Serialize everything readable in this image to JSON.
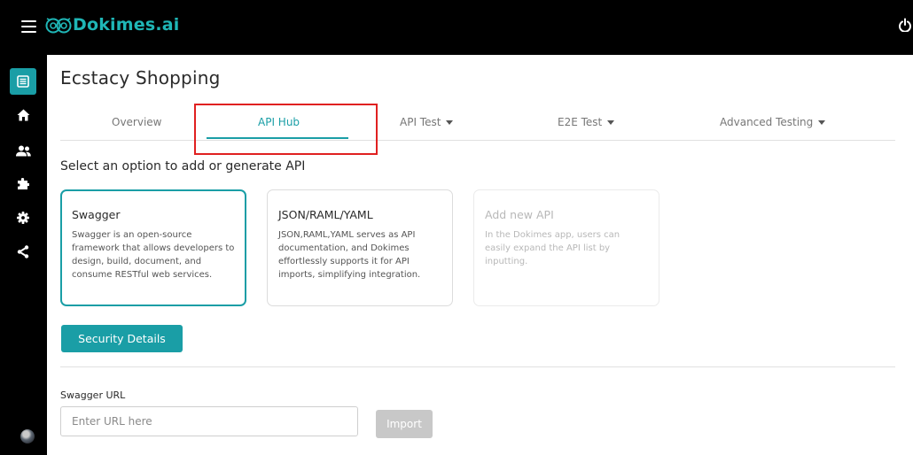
{
  "app": {
    "brand_name": "Dokimes.ai",
    "accent_color": "#1a9ea6",
    "logo_color": "#1fb6b6"
  },
  "topbar": {
    "menu_icon": "hamburger-icon",
    "power_icon": "power-icon"
  },
  "sidebar": {
    "items": [
      {
        "icon": "list-icon",
        "active": true
      },
      {
        "icon": "home-icon",
        "active": false
      },
      {
        "icon": "users-icon",
        "active": false
      },
      {
        "icon": "puzzle-icon",
        "active": false
      },
      {
        "icon": "gear-icon",
        "active": false
      },
      {
        "icon": "share-icon",
        "active": false
      }
    ],
    "avatar": "user-avatar"
  },
  "page": {
    "title": "Ecstacy Shopping"
  },
  "tabs": [
    {
      "label": "Overview",
      "active": false,
      "has_dropdown": false
    },
    {
      "label": "API Hub",
      "active": true,
      "has_dropdown": false
    },
    {
      "label": "API Test",
      "active": false,
      "has_dropdown": true
    },
    {
      "label": "E2E Test",
      "active": false,
      "has_dropdown": true
    },
    {
      "label": "Advanced Testing",
      "active": false,
      "has_dropdown": true
    }
  ],
  "section": {
    "heading": "Select an option to add or generate API"
  },
  "cards": [
    {
      "title": "Swagger",
      "description": "Swagger is an open-source framework that allows developers to design, build, document, and consume RESTful web services.",
      "selected": true,
      "disabled": false
    },
    {
      "title": "JSON/RAML/YAML",
      "description": "JSON,RAML,YAML serves as API documentation, and Dokimes effortlessly supports it for API imports, simplifying integration.",
      "selected": false,
      "disabled": false
    },
    {
      "title": "Add new API",
      "description": "In the Dokimes app, users can easily expand the API list by inputting.",
      "selected": false,
      "disabled": true
    }
  ],
  "actions": {
    "security_details_label": "Security Details"
  },
  "swagger_form": {
    "url_label": "Swagger URL",
    "url_placeholder": "Enter URL here",
    "url_value": "",
    "import_label": "Import"
  }
}
